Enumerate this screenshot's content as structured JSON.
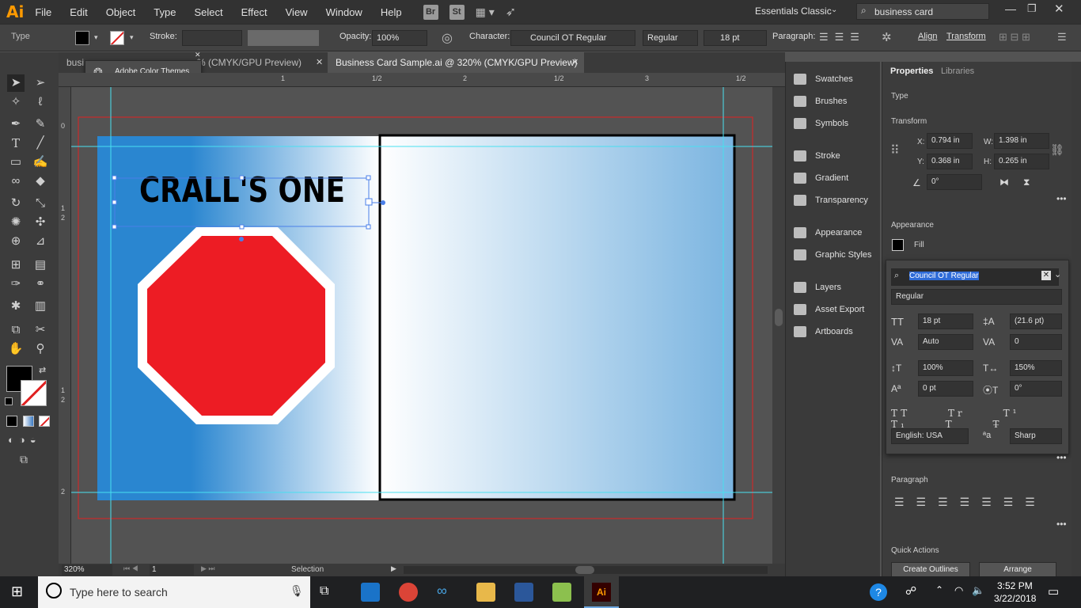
{
  "app": {
    "logo": "Ai",
    "workspace": "Essentials Classic",
    "search_value": "business card"
  },
  "menu": [
    "File",
    "Edit",
    "Object",
    "Type",
    "Select",
    "Effect",
    "View",
    "Window",
    "Help"
  ],
  "menu_icons": {
    "bridge": "Br",
    "stock": "St"
  },
  "control_bar": {
    "object_type": "Type",
    "stroke_label": "Stroke:",
    "opacity_label": "Opacity:",
    "opacity_value": "100%",
    "character_label": "Character:",
    "font_name": "Council OT Regular",
    "font_style": "Regular",
    "font_size": "18 pt",
    "paragraph_label": "Paragraph:",
    "align_label": "Align",
    "transform_label": "Transform"
  },
  "tabs": [
    {
      "label": "busi"
    },
    {
      "label": "% (CMYK/GPU Preview)"
    },
    {
      "label": "Business Card Sample.ai @ 320% (CMYK/GPU Preview)"
    }
  ],
  "tooltip": {
    "label": "Adobe Color Themes"
  },
  "rulers": {
    "top": [
      "1",
      "1/2",
      "2",
      "1/2",
      "3",
      "1/2"
    ],
    "left": [
      "0",
      "1",
      "2",
      "1",
      "2",
      "2"
    ]
  },
  "artwork": {
    "title_text": "CRALL'S ONE"
  },
  "status": {
    "zoom": "320%",
    "artboard": "1",
    "tool": "Selection"
  },
  "panel_list": [
    "Swatches",
    "Brushes",
    "Symbols",
    "Stroke",
    "Gradient",
    "Transparency",
    "Appearance",
    "Graphic Styles",
    "Layers",
    "Asset Export",
    "Artboards"
  ],
  "properties": {
    "tab_properties": "Properties",
    "tab_libraries": "Libraries",
    "type_heading": "Type",
    "transform_heading": "Transform",
    "x_label": "X:",
    "x_value": "0.794 in",
    "y_label": "Y:",
    "y_value": "0.368 in",
    "w_label": "W:",
    "w_value": "1.398 in",
    "h_label": "H:",
    "h_value": "0.265 in",
    "angle_value": "0°",
    "appearance_heading": "Appearance",
    "fill_label": "Fill",
    "font_name": "Council OT Regular",
    "font_style": "Regular",
    "font_size": "18 pt",
    "leading": "(21.6 pt)",
    "kerning": "Auto",
    "tracking": "0",
    "v_scale": "100%",
    "h_scale": "150%",
    "baseline": "0 pt",
    "rotation": "0°",
    "language": "English: USA",
    "antialias": "Sharp",
    "paragraph_heading": "Paragraph",
    "quick_actions_heading": "Quick Actions",
    "create_outlines": "Create Outlines",
    "arrange": "Arrange"
  },
  "taskbar": {
    "search_placeholder": "Type here to search",
    "time": "3:52 PM",
    "date": "3/22/2018"
  },
  "colors": {
    "accent_orange": "#ff9a00",
    "stop_red": "#ed1c24",
    "guide_cyan": "#48e0f0",
    "card_blue": "#2a86d0"
  }
}
